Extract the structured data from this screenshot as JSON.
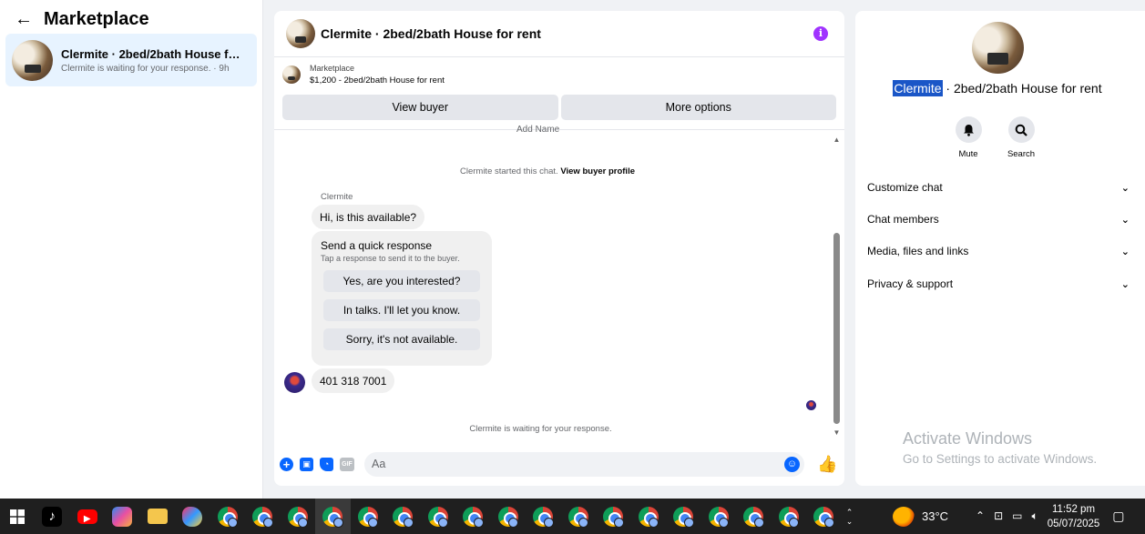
{
  "left_panel": {
    "title": "Marketplace",
    "conversation": {
      "title": "Clermite · 2bed/2bath House for r...",
      "subtitle": "Clermite is waiting for your response. · 9h"
    }
  },
  "chat": {
    "header_title": "Clermite · 2bed/2bath House for rent",
    "info_icon": "i",
    "listing": {
      "label": "Marketplace",
      "price_line": "$1,200 - 2bed/2bath House for rent"
    },
    "actions": {
      "view_buyer": "View buyer",
      "more_options": "More options"
    },
    "partial_top_text": "Add          Name",
    "started_text": "Clermite started this chat.",
    "view_profile_link": "View buyer profile",
    "sender_name": "Clermite",
    "first_message": "Hi, is this available?",
    "quick_response": {
      "title": "Send a quick response",
      "subtitle": "Tap a response to send it to the buyer.",
      "options": [
        "Yes, are you interested?",
        "In talks. I'll let you know.",
        "Sorry, it's not available."
      ]
    },
    "phone_message": "401 318 7001",
    "waiting_text": "Clermite is waiting for your response.",
    "composer": {
      "placeholder": "Aa",
      "gif_label": "GIF"
    }
  },
  "right_panel": {
    "title_highlight": "Clermite",
    "title_rest": " · 2bed/2bath House for rent",
    "actions": [
      {
        "label": "Mute",
        "icon": "bell-icon"
      },
      {
        "label": "Search",
        "icon": "search-icon"
      }
    ],
    "sections": [
      "Customize chat",
      "Chat members",
      "Media, files and links",
      "Privacy & support"
    ],
    "watermark": {
      "title": "Activate Windows",
      "subtitle": "Go to Settings to activate Windows."
    }
  },
  "taskbar": {
    "temperature": "33°C",
    "time": "11:52 pm",
    "date": "05/07/2025",
    "chrome_instances": 18
  }
}
